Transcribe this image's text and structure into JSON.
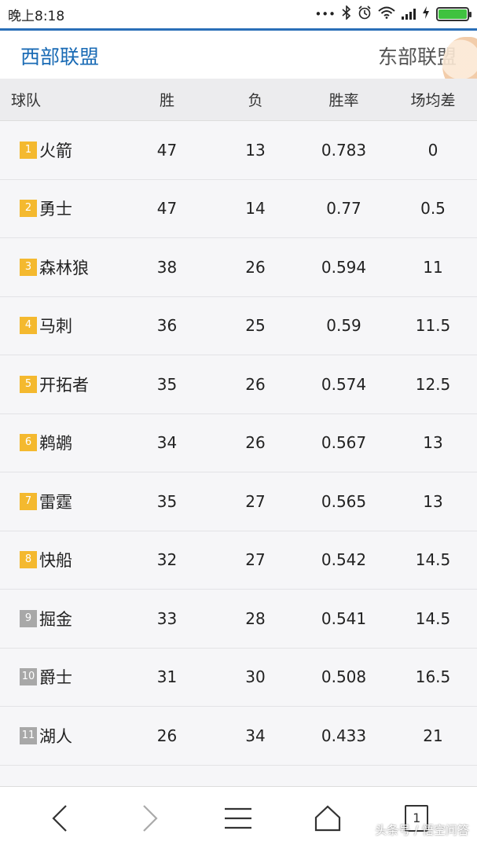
{
  "status_bar": {
    "time": "晚上8:18",
    "battery_level": 1.0,
    "icons": [
      "dots-icon",
      "bluetooth-icon",
      "alarm-icon",
      "wifi-icon",
      "signal-icon",
      "charging-icon",
      "battery-icon"
    ]
  },
  "header": {
    "tab_west": "西部联盟",
    "tab_east": "东部联盟"
  },
  "table": {
    "columns": [
      "球队",
      "胜",
      "负",
      "胜率",
      "场均差"
    ],
    "rows": [
      {
        "rank": "1",
        "team": "火箭",
        "w": "47",
        "l": "13",
        "pct": "0.783",
        "gb": "0"
      },
      {
        "rank": "2",
        "team": "勇士",
        "w": "47",
        "l": "14",
        "pct": "0.77",
        "gb": "0.5"
      },
      {
        "rank": "3",
        "team": "森林狼",
        "w": "38",
        "l": "26",
        "pct": "0.594",
        "gb": "11"
      },
      {
        "rank": "4",
        "team": "马刺",
        "w": "36",
        "l": "25",
        "pct": "0.59",
        "gb": "11.5"
      },
      {
        "rank": "5",
        "team": "开拓者",
        "w": "35",
        "l": "26",
        "pct": "0.574",
        "gb": "12.5"
      },
      {
        "rank": "6",
        "team": "鹈鹕",
        "w": "34",
        "l": "26",
        "pct": "0.567",
        "gb": "13"
      },
      {
        "rank": "7",
        "team": "雷霆",
        "w": "35",
        "l": "27",
        "pct": "0.565",
        "gb": "13"
      },
      {
        "rank": "8",
        "team": "快船",
        "w": "32",
        "l": "27",
        "pct": "0.542",
        "gb": "14.5"
      },
      {
        "rank": "9",
        "team": "掘金",
        "w": "33",
        "l": "28",
        "pct": "0.541",
        "gb": "14.5"
      },
      {
        "rank": "10",
        "team": "爵士",
        "w": "31",
        "l": "30",
        "pct": "0.508",
        "gb": "16.5"
      },
      {
        "rank": "11",
        "team": "湖人",
        "w": "26",
        "l": "34",
        "pct": "0.433",
        "gb": "21"
      }
    ],
    "colors": {
      "playoff": "#f4b92f",
      "non_playoff": "#a8a8a8"
    }
  },
  "bottom_bar": {
    "tab_count": "1",
    "watermark": "头条号 / 悟空问答"
  }
}
